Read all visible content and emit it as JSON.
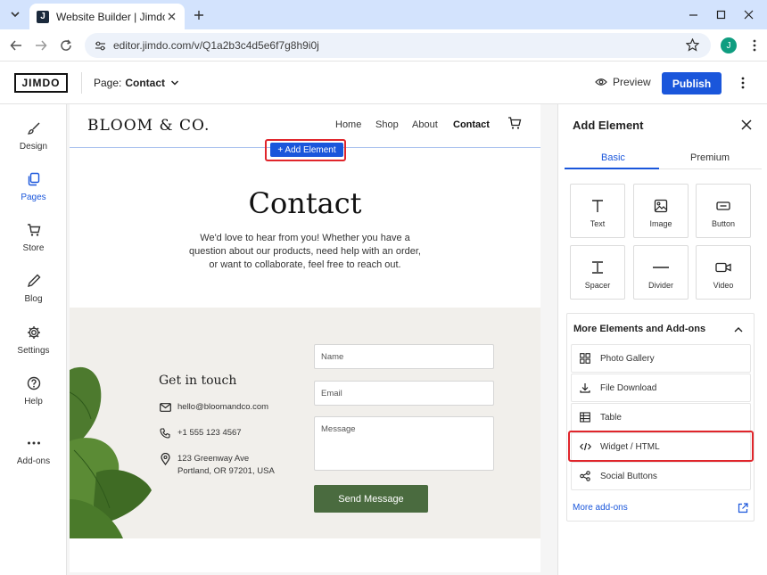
{
  "browser": {
    "tab_title": "Website Builder | Jimdo",
    "tab_favicon": "J",
    "url": "editor.jimdo.com/v/Q1a2b3c4d5e6f7g8h9i0j",
    "profile_initial": "J"
  },
  "header": {
    "logo": "JIMDO",
    "page_label": "Page:",
    "page_value": "Contact",
    "preview_label": "Preview",
    "publish_label": "Publish"
  },
  "sidebar": {
    "items": [
      {
        "label": "Design",
        "icon": "brush-icon"
      },
      {
        "label": "Pages",
        "icon": "pages-icon",
        "active": true
      },
      {
        "label": "Store",
        "icon": "cart-icon"
      },
      {
        "label": "Blog",
        "icon": "pen-icon"
      },
      {
        "label": "Settings",
        "icon": "gear-icon"
      },
      {
        "label": "Help",
        "icon": "help-icon"
      },
      {
        "label": "Add-ons",
        "icon": "more-dots-icon"
      }
    ]
  },
  "site": {
    "brand": "BLOOM & CO.",
    "nav": [
      "Home",
      "Shop",
      "About",
      "Contact"
    ],
    "add_element": "+ Add Element",
    "hero_title": "Contact",
    "hero_text": "We'd love to hear from you! Whether you have a question about our products, need help with an order, or want to collaborate, feel free to reach out.",
    "get_in_touch": "Get in touch",
    "email": "hello@bloomandco.com",
    "phone": "+1 555 123 4567",
    "address_line1": "123 Greenway Ave",
    "address_line2": "Portland, OR 97201, USA",
    "form": {
      "name_placeholder": "Name",
      "email_placeholder": "Email",
      "message_placeholder": "Message",
      "send_label": "Send Message"
    }
  },
  "panel": {
    "title": "Add Element",
    "tabs": [
      "Basic",
      "Premium"
    ],
    "basic_items": [
      "Text",
      "Image",
      "Button",
      "Spacer",
      "Divider",
      "Video"
    ],
    "more_title": "More Elements and Add-ons",
    "more_items": [
      "Photo Gallery",
      "File Download",
      "Table",
      "Widget / HTML",
      "Social Buttons"
    ],
    "more_addons": "More add-ons"
  },
  "colors": {
    "accent": "#1a56db",
    "highlight": "#e0252b",
    "send_button": "#4a6b3f"
  }
}
